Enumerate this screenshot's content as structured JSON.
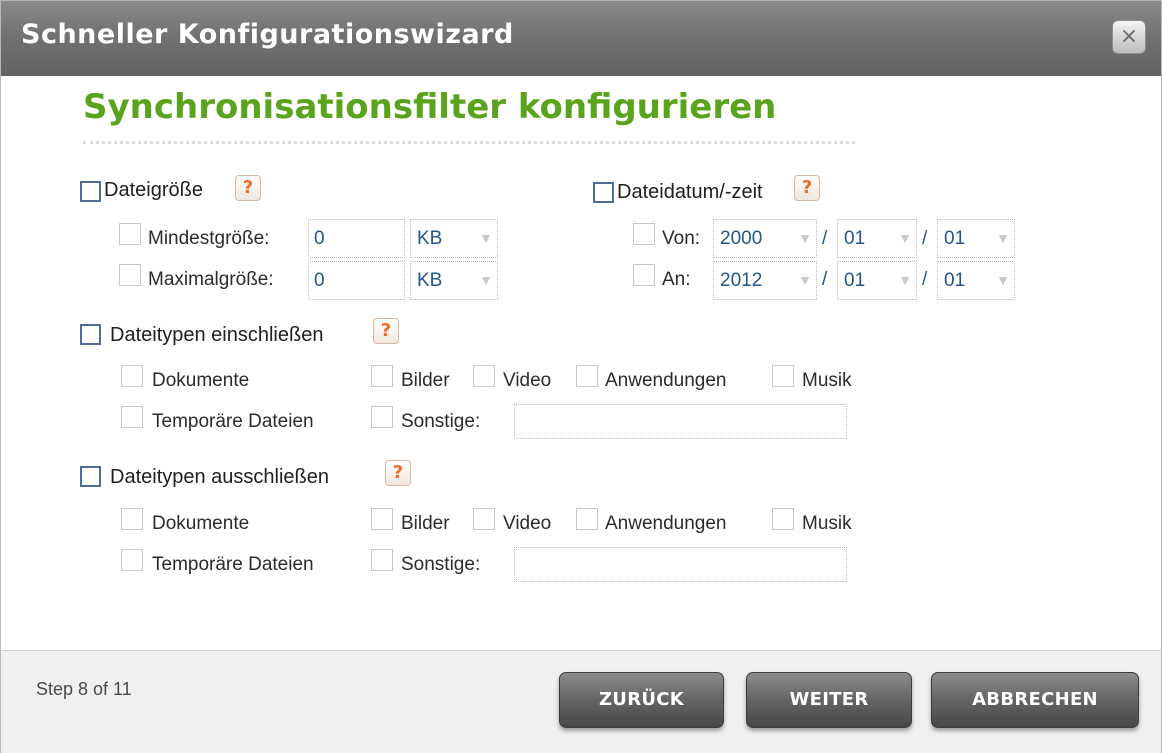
{
  "dialog": {
    "title": "Schneller Konfigurationswizard",
    "close_glyph": "×",
    "heading": "Synchronisationsfilter konfigurieren"
  },
  "help_glyph": "?",
  "filesize": {
    "label": "Dateigröße",
    "min": {
      "label": "Mindestgröße:",
      "value": "0",
      "unit": "KB"
    },
    "max": {
      "label": "Maximalgröße:",
      "value": "0",
      "unit": "KB"
    }
  },
  "filedate": {
    "label": "Dateidatum/-zeit",
    "from": {
      "label": "Von:",
      "year": "2000",
      "month": "01",
      "day": "01"
    },
    "to": {
      "label": "An:",
      "year": "2012",
      "month": "01",
      "day": "01"
    },
    "separator": "/"
  },
  "include": {
    "label": "Dateitypen einschließen",
    "types": {
      "documents": "Dokumente",
      "images": "Bilder",
      "video": "Video",
      "applications": "Anwendungen",
      "music": "Musik",
      "temp": "Temporäre Dateien",
      "other": "Sonstige:"
    },
    "other_value": ""
  },
  "exclude": {
    "label": "Dateitypen ausschließen",
    "types": {
      "documents": "Dokumente",
      "images": "Bilder",
      "video": "Video",
      "applications": "Anwendungen",
      "music": "Musik",
      "temp": "Temporäre Dateien",
      "other": "Sonstige:"
    },
    "other_value": ""
  },
  "footer": {
    "step": "Step 8 of 11",
    "back": "ZURÜCK",
    "next": "WEITER",
    "cancel": "ABBRECHEN"
  },
  "colors": {
    "heading": "#5aa41d",
    "help_icon": "#ec6d24",
    "titlebar": "#727272",
    "button": "#646464",
    "field_text": "#24568b"
  }
}
